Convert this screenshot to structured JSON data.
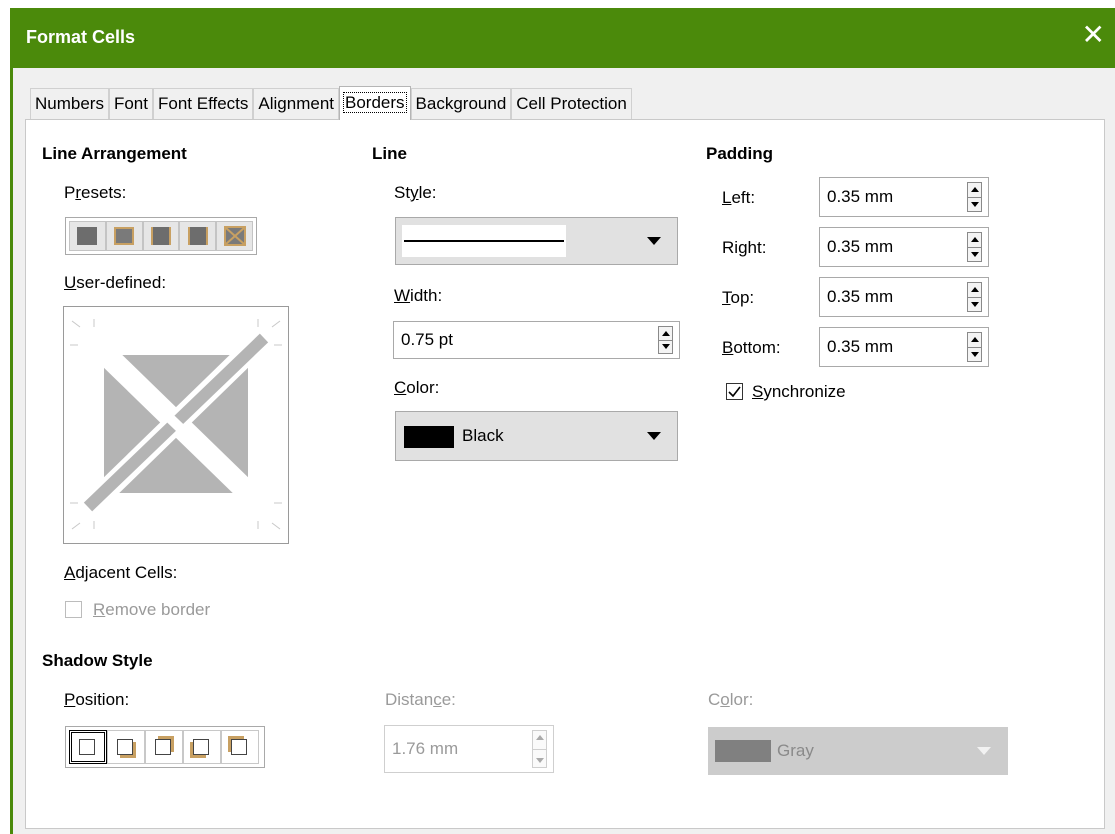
{
  "window": {
    "title": "Format Cells",
    "close_glyph": "✕"
  },
  "tabs": [
    {
      "label": "Numbers",
      "active": false
    },
    {
      "label": "Font",
      "active": false
    },
    {
      "label": "Font Effects",
      "active": false
    },
    {
      "label": "Alignment",
      "active": false
    },
    {
      "label": "Borders",
      "active": true
    },
    {
      "label": "Background",
      "active": false
    },
    {
      "label": "Cell Protection",
      "active": false
    }
  ],
  "line_arrangement": {
    "heading": "Line Arrangement",
    "presets_label_pre": "P",
    "presets_label_u": "r",
    "presets_label_post": "esets:",
    "user_defined_pre": "",
    "user_defined_u": "U",
    "user_defined_post": "ser-defined:",
    "presets": [
      "preset-none",
      "preset-outer",
      "preset-outer-horizontal",
      "preset-outer-all-inner",
      "preset-outer-no-inner"
    ]
  },
  "adjacent": {
    "heading_u": "A",
    "heading_post": "djacent Cells:",
    "remove_pre": "",
    "remove_u": "R",
    "remove_post": "emove border",
    "remove_checked": false,
    "remove_enabled": false
  },
  "line": {
    "heading": "Line",
    "style_pre": "St",
    "style_u": "y",
    "style_post": "le:",
    "width_pre": "",
    "width_u": "W",
    "width_post": "idth:",
    "width_value": "0.75 pt",
    "color_pre": "",
    "color_u": "C",
    "color_post": "olor:",
    "color_value": "Black",
    "color_swatch": "#000000"
  },
  "padding": {
    "heading": "Padding",
    "left_pre": "",
    "left_u": "L",
    "left_post": "eft:",
    "left_value": "0.35 mm",
    "right_pre": "Ri",
    "right_u": "g",
    "right_post": "ht:",
    "right_value": "0.35 mm",
    "top_pre": "",
    "top_u": "T",
    "top_post": "op:",
    "top_value": "0.35 mm",
    "bottom_pre": "",
    "bottom_u": "B",
    "bottom_post": "ottom:",
    "bottom_value": "0.35 mm",
    "sync_pre": "",
    "sync_u": "S",
    "sync_post": "ynchronize",
    "sync_checked": true
  },
  "shadow": {
    "heading": "Shadow Style",
    "position_pre": "",
    "position_u": "P",
    "position_post": "osition:",
    "distance_pre": "Distan",
    "distance_u": "c",
    "distance_post": "e:",
    "distance_value": "1.76 mm",
    "color_pre": "C",
    "color_u": "o",
    "color_post": "lor:",
    "color_value": "Gray",
    "color_swatch": "#808080"
  },
  "colors": {
    "titlebar": "#4b8a0b",
    "preset_accent": "#c8a062"
  }
}
